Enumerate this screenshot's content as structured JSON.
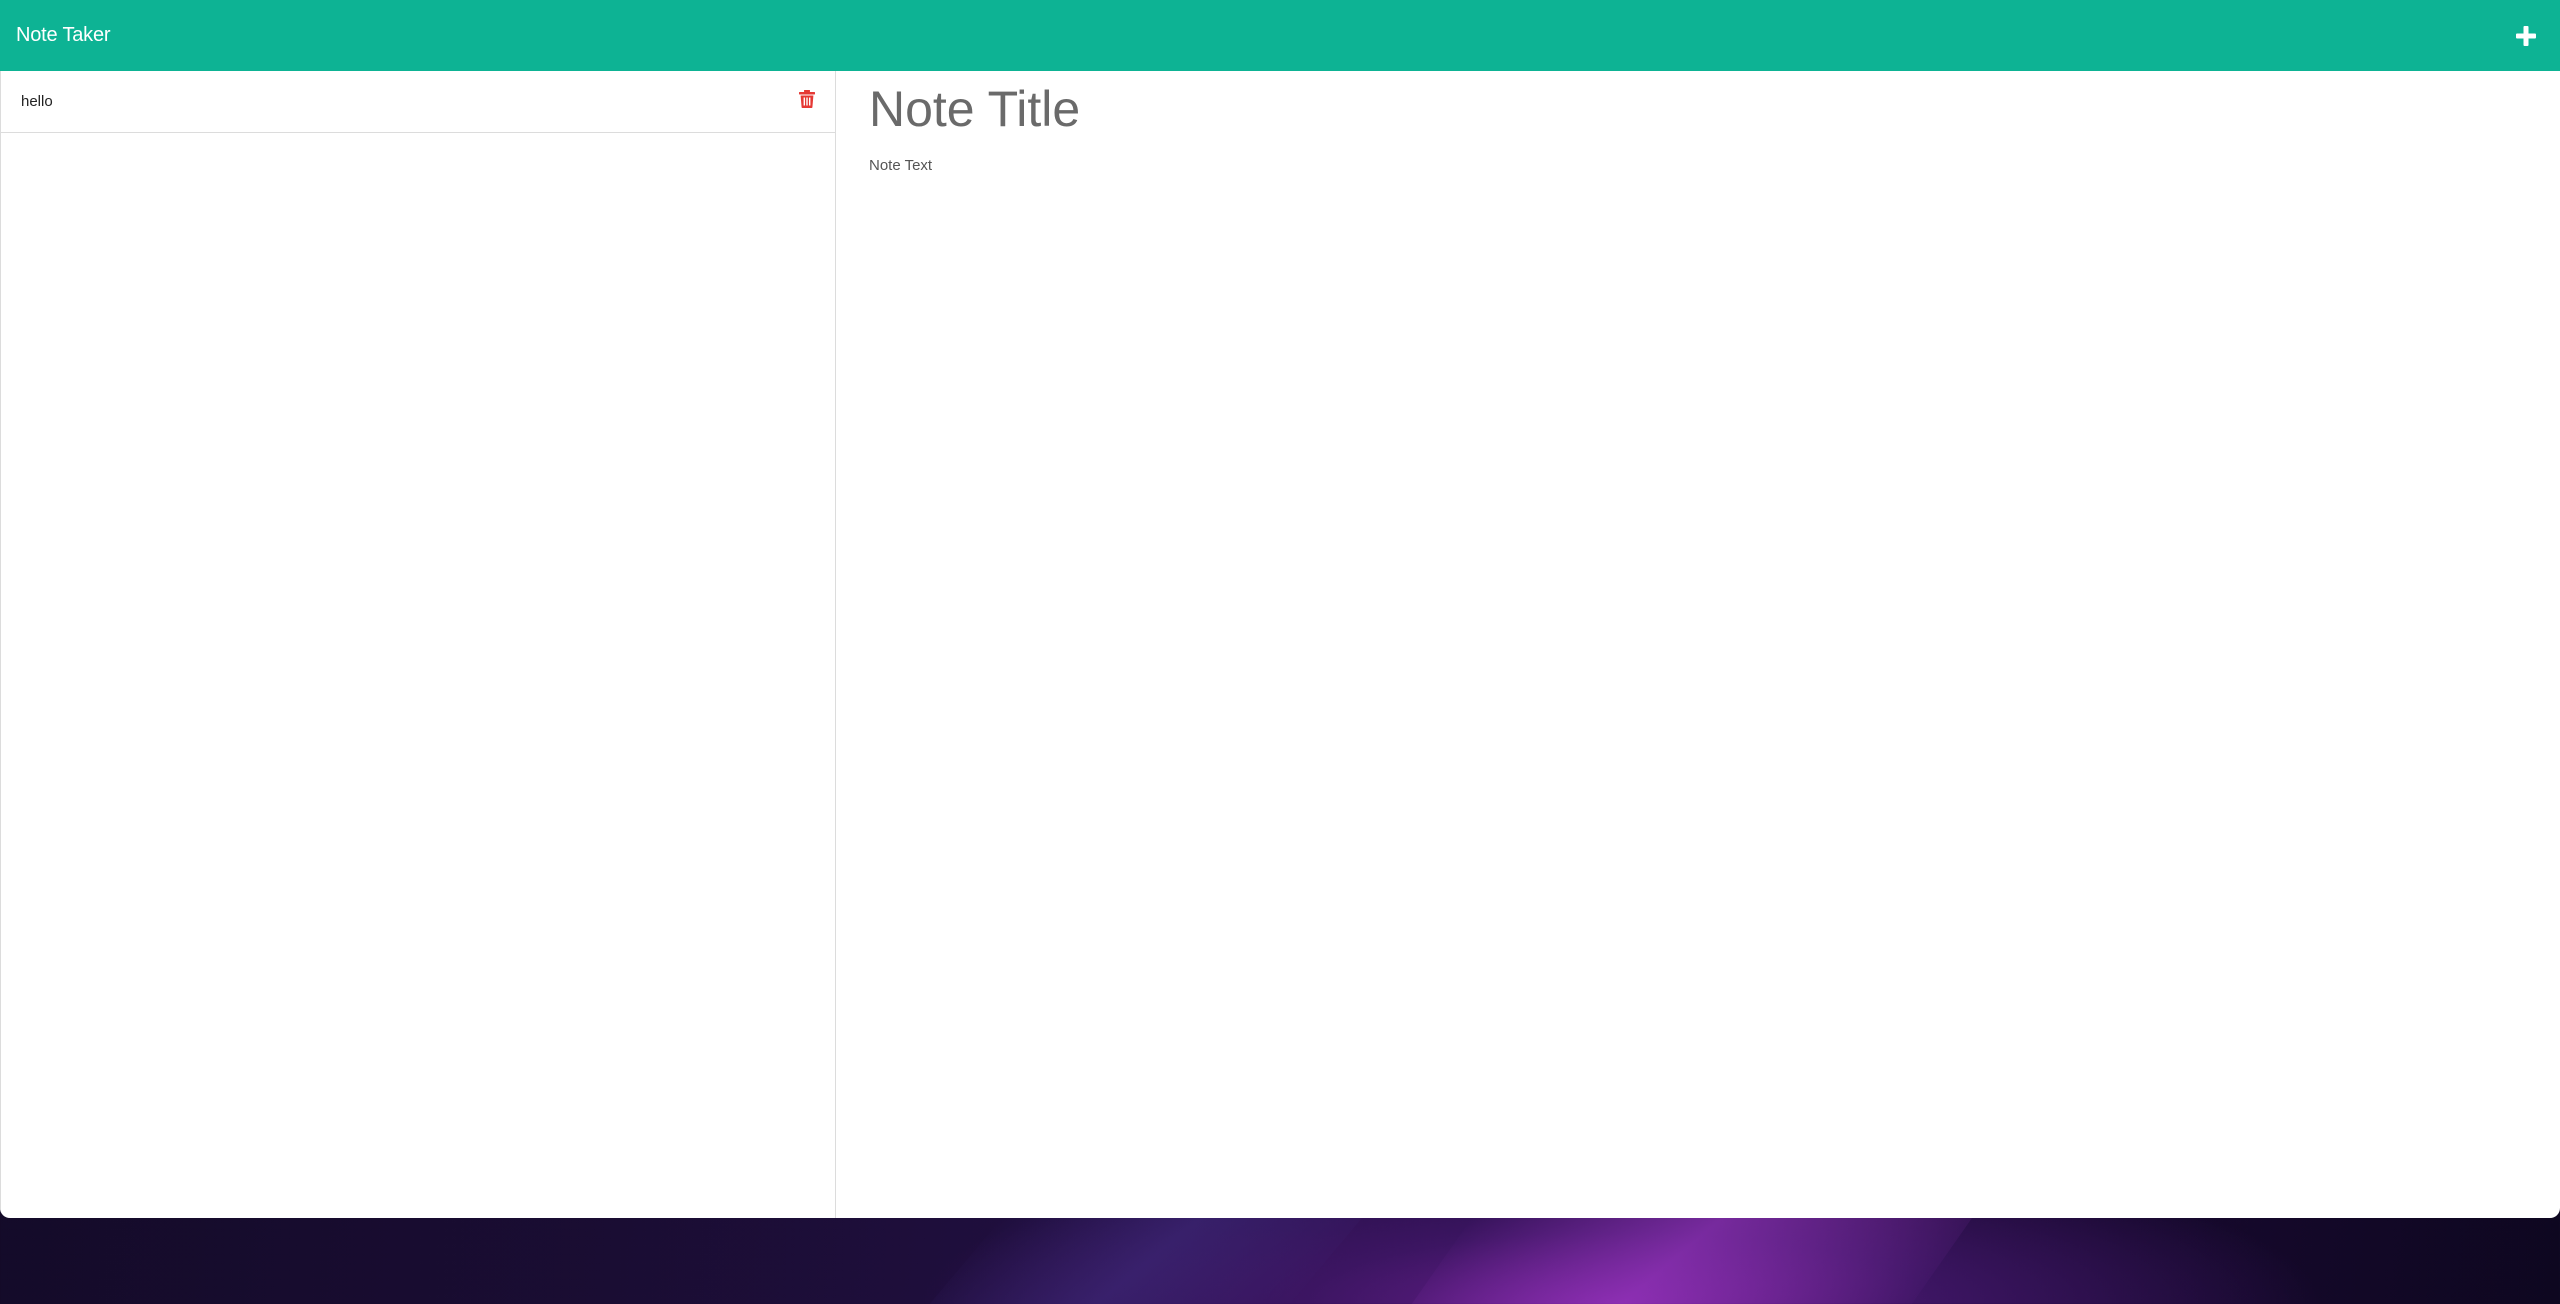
{
  "colors": {
    "navbar_bg": "#0db394",
    "delete_icon": "#e53935",
    "plus_icon": "#ffffff"
  },
  "navbar": {
    "brand": "Note Taker",
    "new_note_icon": "plus-icon"
  },
  "sidebar": {
    "notes": [
      {
        "title": "hello",
        "delete_icon": "trash-icon"
      }
    ]
  },
  "editor": {
    "title_placeholder": "Note Title",
    "text_placeholder": "Note Text"
  }
}
